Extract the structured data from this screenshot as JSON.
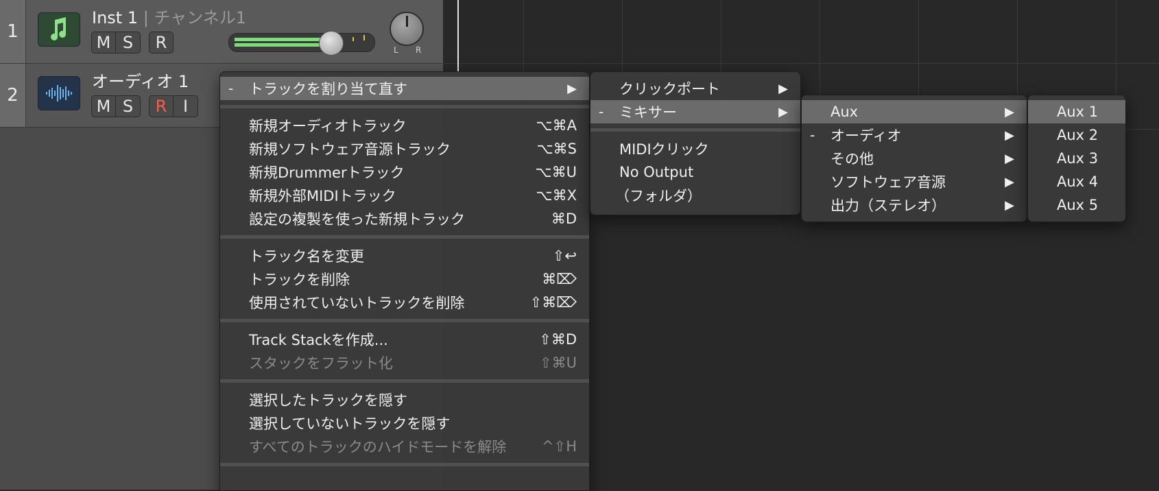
{
  "tracks": [
    {
      "number": "1",
      "name": "Inst 1",
      "separator": "|",
      "channel": "チャンネル1",
      "buttons": [
        "M",
        "S",
        "R"
      ],
      "icon": "music-note-icon"
    },
    {
      "number": "2",
      "name": "オーディオ 1",
      "buttons": [
        "M",
        "S",
        "R",
        "I"
      ],
      "icon": "waveform-icon"
    }
  ],
  "pan": {
    "left": "L",
    "right": "R"
  },
  "menu": {
    "reassign": {
      "mark": "-",
      "label": "トラックを割り当て直す",
      "arrow": "▶"
    },
    "new_audio": {
      "label": "新規オーディオトラック",
      "shortcut": "⌥⌘A"
    },
    "new_software": {
      "label": "新規ソフトウェア音源トラック",
      "shortcut": "⌥⌘S"
    },
    "new_drummer": {
      "label": "新規Drummerトラック",
      "shortcut": "⌥⌘U"
    },
    "new_midi": {
      "label": "新規外部MIDIトラック",
      "shortcut": "⌥⌘X"
    },
    "new_dup": {
      "label": "設定の複製を使った新規トラック",
      "shortcut": "⌘D"
    },
    "rename": {
      "label": "トラック名を変更",
      "shortcut": "⇧↩"
    },
    "delete": {
      "label": "トラックを削除",
      "shortcut": "⌘⌦"
    },
    "delete_unused": {
      "label": "使用されていないトラックを削除",
      "shortcut": "⇧⌘⌦"
    },
    "create_stack": {
      "label": "Track Stackを作成...",
      "shortcut": "⇧⌘D"
    },
    "flatten_stack": {
      "label": "スタックをフラット化",
      "shortcut": "⇧⌘U"
    },
    "hide_selected": {
      "label": "選択したトラックを隠す"
    },
    "hide_unselected": {
      "label": "選択していないトラックを隠す"
    },
    "unhide_all": {
      "label": "すべてのトラックのハイドモードを解除",
      "shortcut": "^⇧H"
    }
  },
  "submenu1": {
    "click_port": {
      "label": "クリックポート",
      "arrow": "▶"
    },
    "mixer": {
      "mark": "-",
      "label": "ミキサー",
      "arrow": "▶"
    },
    "midi_click": {
      "label": "MIDIクリック"
    },
    "no_output": {
      "label": "No Output"
    },
    "folder": {
      "label": "（フォルダ）"
    }
  },
  "submenu2": {
    "aux": {
      "label": "Aux",
      "arrow": "▶"
    },
    "audio": {
      "mark": "-",
      "label": "オーディオ",
      "arrow": "▶"
    },
    "other": {
      "label": "その他",
      "arrow": "▶"
    },
    "software": {
      "label": "ソフトウェア音源",
      "arrow": "▶"
    },
    "output": {
      "label": "出力（ステレオ）",
      "arrow": "▶"
    }
  },
  "submenu3": {
    "items": [
      "Aux 1",
      "Aux 2",
      "Aux 3",
      "Aux 4",
      "Aux 5"
    ]
  },
  "colors": {
    "highlight": "#6b6b6b",
    "record_red": "#ff5b4d",
    "meter_green": "#7fdc7a"
  }
}
